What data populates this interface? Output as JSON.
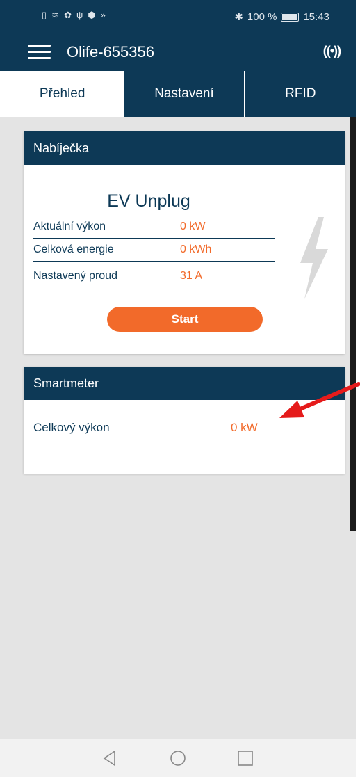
{
  "status_bar": {
    "left_icons": [
      "sim-icon",
      "wifi-icon",
      "settings-icon",
      "usb-icon",
      "shield-icon",
      "cast-icon"
    ],
    "bluetooth": "✱",
    "battery_text": "100 %",
    "time": "15:43"
  },
  "app_bar": {
    "title": "Olife-655356",
    "signal_glyph": "((•))"
  },
  "tabs": [
    {
      "label": "Přehled",
      "active": true
    },
    {
      "label": "Nastavení",
      "active": false
    },
    {
      "label": "RFID",
      "active": false
    }
  ],
  "charger": {
    "header": "Nabíječka",
    "status": "EV Unplug",
    "rows": [
      {
        "label": "Aktuální výkon",
        "value": "0 kW"
      },
      {
        "label": "Celková energie",
        "value": "0 kWh"
      },
      {
        "label": "Nastavený proud",
        "value": "31 A"
      }
    ],
    "start_label": "Start"
  },
  "smartmeter": {
    "header": "Smartmeter",
    "label": "Celkový výkon",
    "value": "0 kW"
  },
  "colors": {
    "primary": "#0d3956",
    "accent": "#f26a2a",
    "background": "#e4e4e4",
    "annotation_arrow": "#e51b1b"
  }
}
